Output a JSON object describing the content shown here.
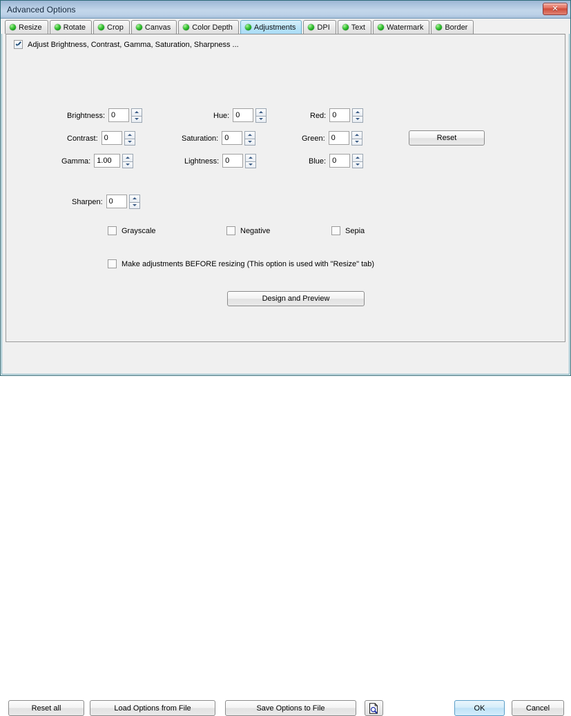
{
  "window": {
    "title": "Advanced Options",
    "close_label": "✕",
    "close_icon": "close-icon",
    "accent_selected_tab": "#b9e4f8",
    "frame_border": "#2e6b78",
    "bullet_color": "#17a01a"
  },
  "tabs": [
    {
      "label": "Resize",
      "selected": false
    },
    {
      "label": "Rotate",
      "selected": false
    },
    {
      "label": "Crop",
      "selected": false
    },
    {
      "label": "Canvas",
      "selected": false
    },
    {
      "label": "Color Depth",
      "selected": false
    },
    {
      "label": "Adjustments",
      "selected": true
    },
    {
      "label": "DPI",
      "selected": false
    },
    {
      "label": "Text",
      "selected": false
    },
    {
      "label": "Watermark",
      "selected": false
    },
    {
      "label": "Border",
      "selected": false
    }
  ],
  "panel": {
    "enable_checkbox": {
      "label": "Adjust Brightness, Contrast, Gamma, Saturation, Sharpness ...",
      "checked": true
    },
    "fields": [
      {
        "label": "Brightness:",
        "value": "0"
      },
      {
        "label": "Contrast:",
        "value": "0"
      },
      {
        "label": "Gamma:",
        "value": "1.00"
      },
      {
        "label": "Hue:",
        "value": "0"
      },
      {
        "label": "Saturation:",
        "value": "0"
      },
      {
        "label": "Lightness:",
        "value": "0"
      },
      {
        "label": "Red:",
        "value": "0"
      },
      {
        "label": "Green:",
        "value": "0"
      },
      {
        "label": "Blue:",
        "value": "0"
      },
      {
        "label": "Sharpen:",
        "value": "0"
      }
    ],
    "reset_button": "Reset",
    "options": [
      {
        "label": "Grayscale",
        "checked": false
      },
      {
        "label": "Negative",
        "checked": false
      },
      {
        "label": "Sepia",
        "checked": false
      }
    ],
    "before_resize": {
      "label": "Make adjustments BEFORE resizing (This option is used with \"Resize\" tab)",
      "checked": false
    },
    "design_preview_button": "Design and Preview"
  },
  "footer": {
    "reset_all": "Reset all",
    "load_options": "Load Options from File",
    "save_options": "Save Options to File",
    "preview_icon": "document-magnifier-icon",
    "ok": "OK",
    "cancel": "Cancel"
  }
}
